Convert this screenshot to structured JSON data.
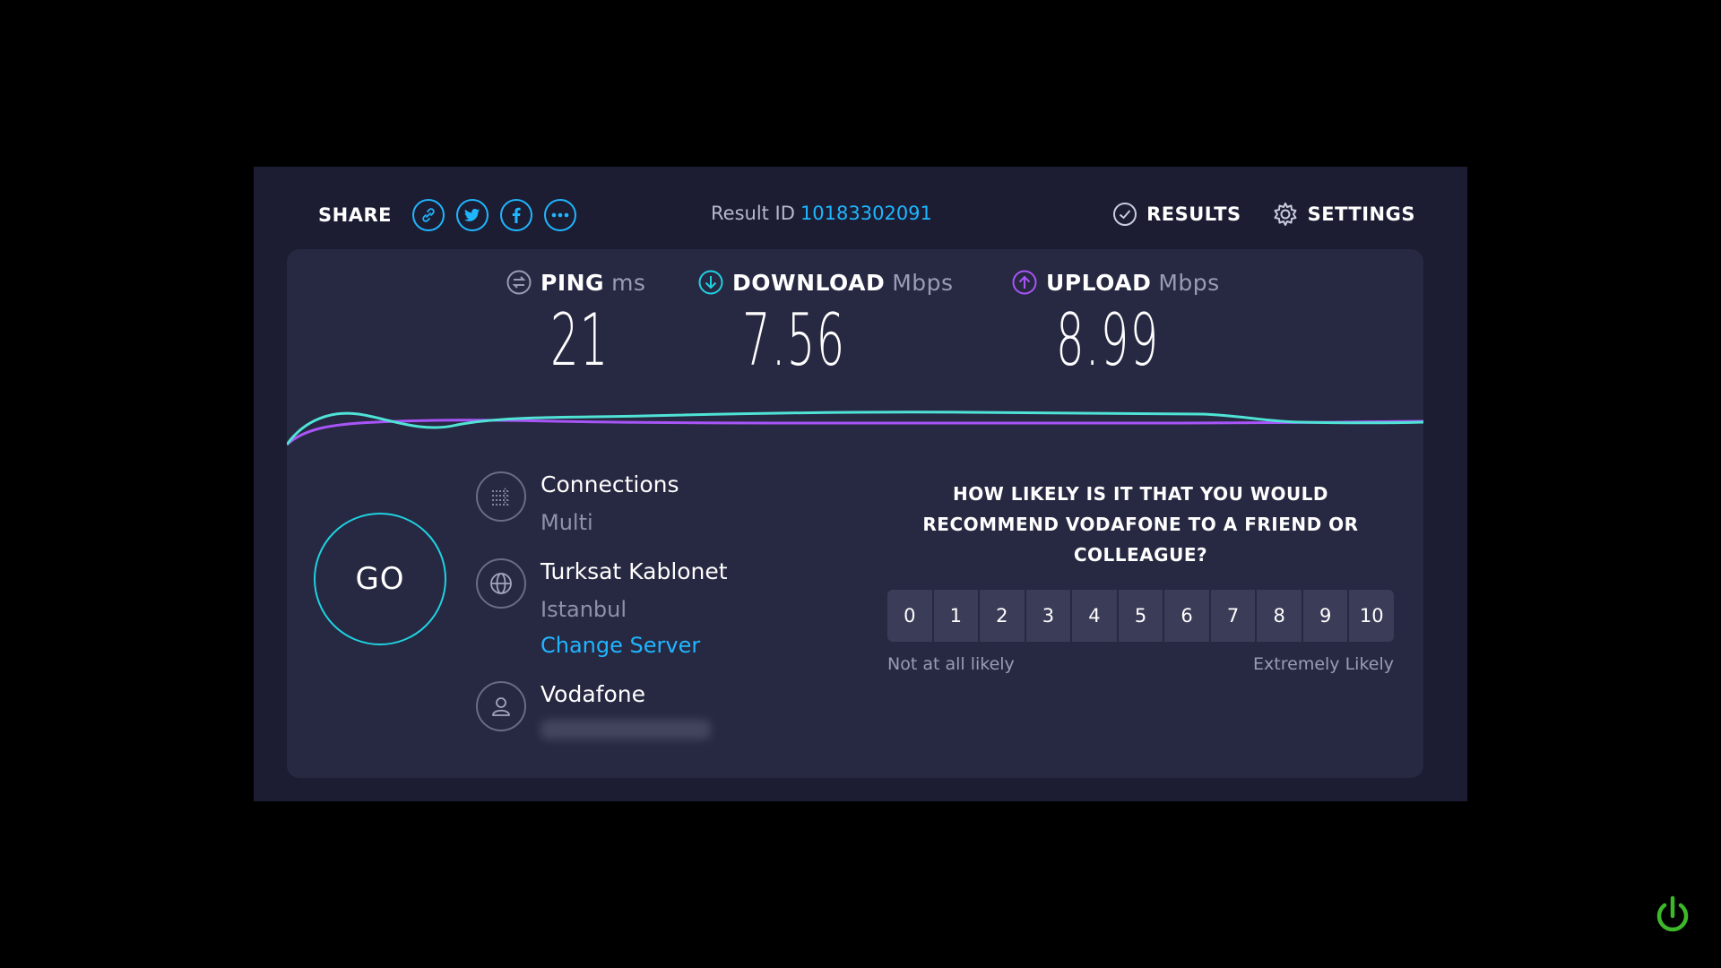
{
  "share": {
    "label": "SHARE",
    "buttons": [
      "link-icon",
      "twitter-icon",
      "facebook-icon",
      "more-icon"
    ]
  },
  "result": {
    "label": "Result ID",
    "id": "10183302091"
  },
  "nav": {
    "results": "RESULTS",
    "settings": "SETTINGS"
  },
  "metrics": {
    "ping": {
      "label": "PING",
      "unit": "ms",
      "value": "21"
    },
    "download": {
      "label": "DOWNLOAD",
      "unit": "Mbps",
      "value": "7.56"
    },
    "upload": {
      "label": "UPLOAD",
      "unit": "Mbps",
      "value": "8.99"
    }
  },
  "go": {
    "label": "GO"
  },
  "connections": {
    "title": "Connections",
    "value": "Multi"
  },
  "server": {
    "name": "Turksat Kablonet",
    "location": "Istanbul",
    "change_label": "Change Server"
  },
  "provider": {
    "name": "Vodafone",
    "ip_hidden": ""
  },
  "survey": {
    "question": "HOW LIKELY IS IT THAT YOU WOULD RECOMMEND VODAFONE TO A FRIEND OR COLLEAGUE?",
    "scale": [
      "0",
      "1",
      "2",
      "3",
      "4",
      "5",
      "6",
      "7",
      "8",
      "9",
      "10"
    ],
    "low_label": "Not at all likely",
    "high_label": "Extremely Likely"
  },
  "colors": {
    "background": "#1c1d33",
    "panel": "#272842",
    "accent": "#1fb6ff",
    "download": "#1fd2e0",
    "upload": "#a855f7"
  }
}
